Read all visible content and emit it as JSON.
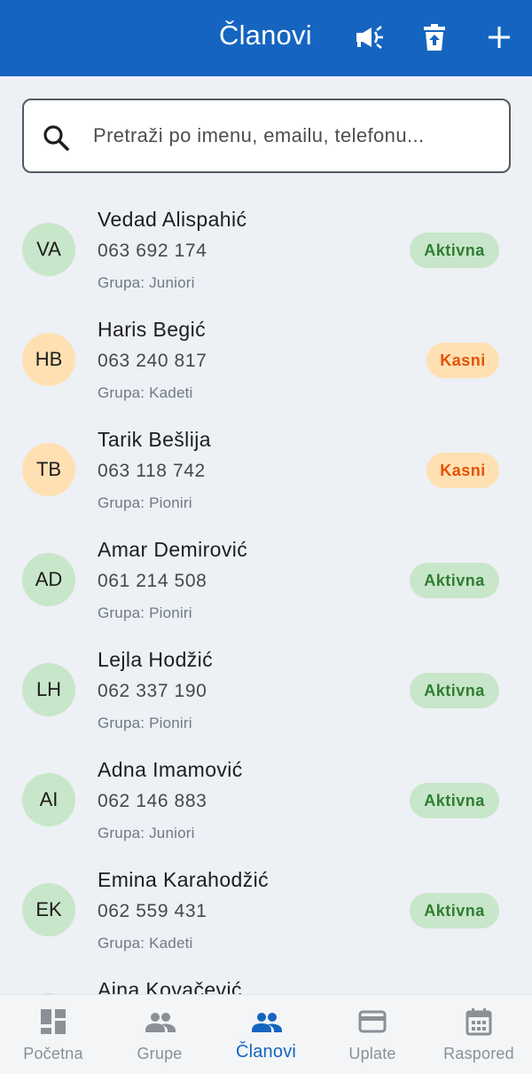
{
  "header": {
    "title": "Članovi",
    "actions": [
      {
        "icon": "megaphone-icon"
      },
      {
        "icon": "delete-restore-icon"
      },
      {
        "icon": "add-icon"
      }
    ]
  },
  "search": {
    "placeholder": "Pretraži po imenu, emailu, telefonu..."
  },
  "members": [
    {
      "initials": "VA",
      "name": "Vedad Alispahić",
      "phone": "063 692 174",
      "group": "Grupa: Juniori",
      "status": "Aktivna",
      "status_type": "aktivna",
      "avatar_color": "#c8e6c9"
    },
    {
      "initials": "HB",
      "name": "Haris Begić",
      "phone": "063 240 817",
      "group": "Grupa: Kadeti",
      "status": "Kasni",
      "status_type": "kasni",
      "avatar_color": "#ffe0b2"
    },
    {
      "initials": "TB",
      "name": "Tarik Bešlija",
      "phone": "063 118 742",
      "group": "Grupa: Pioniri",
      "status": "Kasni",
      "status_type": "kasni",
      "avatar_color": "#ffe0b2"
    },
    {
      "initials": "AD",
      "name": "Amar Demirović",
      "phone": "061 214 508",
      "group": "Grupa: Pioniri",
      "status": "Aktivna",
      "status_type": "aktivna",
      "avatar_color": "#c8e6c9"
    },
    {
      "initials": "LH",
      "name": "Lejla Hodžić",
      "phone": "062 337 190",
      "group": "Grupa: Pioniri",
      "status": "Aktivna",
      "status_type": "aktivna",
      "avatar_color": "#c8e6c9"
    },
    {
      "initials": "AI",
      "name": "Adna Imamović",
      "phone": "062 146 883",
      "group": "Grupa: Juniori",
      "status": "Aktivna",
      "status_type": "aktivna",
      "avatar_color": "#c8e6c9"
    },
    {
      "initials": "EK",
      "name": "Emina Karahodžić",
      "phone": "062 559 431",
      "group": "Grupa: Kadeti",
      "status": "Aktivna",
      "status_type": "aktivna",
      "avatar_color": "#c8e6c9"
    },
    {
      "initials": "",
      "name": "Ajna Kovačević",
      "phone": "",
      "group": "",
      "status": "",
      "status_type": "",
      "avatar_color": "#c8e6c9"
    }
  ],
  "bottom_nav": [
    {
      "label": "Početna",
      "icon": "dashboard-icon",
      "active": false
    },
    {
      "label": "Grupe",
      "icon": "people-icon",
      "active": false
    },
    {
      "label": "Članovi",
      "icon": "members-icon",
      "active": true
    },
    {
      "label": "Uplate",
      "icon": "credit-card-icon",
      "active": false
    },
    {
      "label": "Raspored",
      "icon": "calendar-icon",
      "active": false
    }
  ],
  "colors": {
    "primary": "#1565c0",
    "background": "#edf0f4",
    "active_badge_bg": "#c8e6c9",
    "active_badge_text": "#2e7d32",
    "late_badge_bg": "#ffe0b2",
    "late_badge_text": "#e65100"
  }
}
